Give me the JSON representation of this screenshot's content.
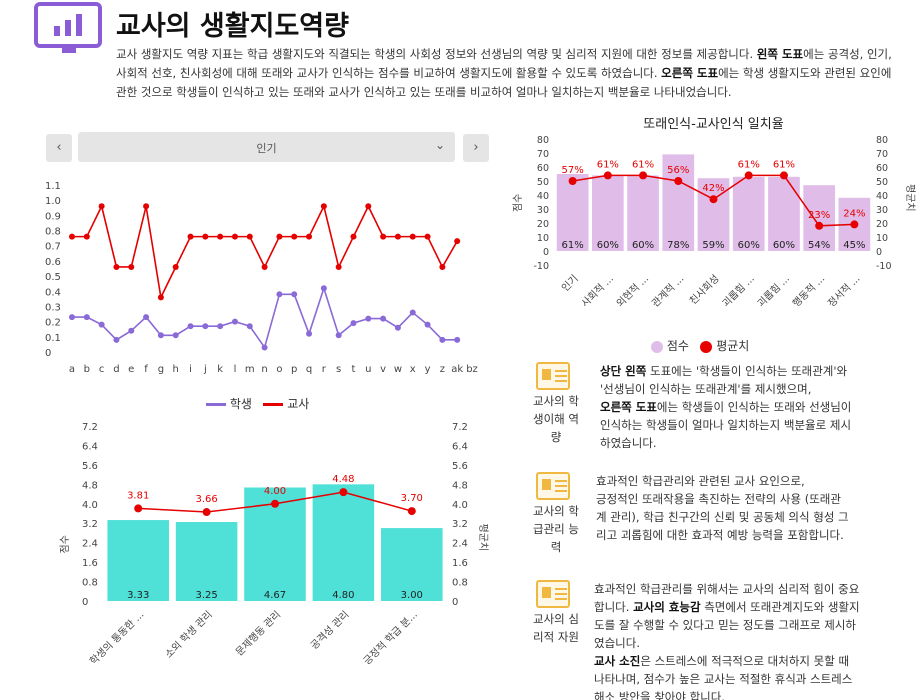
{
  "header": {
    "title": "교사의 생활지도역량",
    "desc_1": "교사 생활지도 역량 지표는 학급 생활지도와 직결되는 학생의 사회성 정보와 선생님의 역량 및 심리적 지원에 대한 정보를 제공합니다. ",
    "desc_b1": "왼쪽 도표",
    "desc_2": "에는 공격성, 인기, 사회적 선호, 친사회성에 대해 또래와 교사가 인식하는 점수를 비교하여 생활지도에 활용할 수 있도록 하였습니다. ",
    "desc_b2": "오른쪽 도표",
    "desc_3": "에는 학생 생활지도와 관련된 요인에 관한 것으로 학생들이 인식하고 있는 또래와 교사가 인식하고 있는 또래를 비교하여 얼마나 일치하는지 백분율로 나타내었습니다."
  },
  "selector": {
    "prev": "‹",
    "next": "›",
    "value": "인기",
    "caret": "⌄"
  },
  "colors": {
    "accent": "#8a5cd6",
    "student": "#8a6ad6",
    "teacher": "#e50000",
    "bar": "#e0bde8",
    "teal": "#4fe0d8",
    "red_dot": "#e60000"
  },
  "chart_data": [
    {
      "type": "line",
      "x": [
        "a",
        "b",
        "c",
        "d",
        "e",
        "f",
        "g",
        "h",
        "i",
        "j",
        "k",
        "l",
        "m",
        "n",
        "o",
        "p",
        "q",
        "r",
        "s",
        "t",
        "u",
        "v",
        "w",
        "x",
        "y",
        "z",
        "ak",
        "bz"
      ],
      "yticks": [
        "1.1",
        "1.0",
        "0.9",
        "0.8",
        "0.7",
        "0.6",
        "0.5",
        "0.4",
        "0.3",
        "0.2",
        "0.1",
        "0"
      ],
      "ylim": [
        0,
        1.1
      ],
      "series": [
        {
          "name": "학생",
          "values": [
            0.23,
            0.23,
            0.18,
            0.08,
            0.14,
            0.23,
            0.11,
            0.11,
            0.17,
            0.17,
            0.17,
            0.2,
            0.17,
            0.03,
            0.38,
            0.38,
            0.12,
            0.42,
            0.11,
            0.19,
            0.22,
            0.22,
            0.16,
            0.26,
            0.18,
            0.08,
            0.08,
            null
          ]
        },
        {
          "name": "교사",
          "values": [
            0.76,
            0.76,
            0.96,
            0.56,
            0.56,
            0.96,
            0.36,
            0.56,
            0.76,
            0.76,
            0.76,
            0.76,
            0.76,
            0.56,
            0.76,
            0.76,
            0.76,
            0.96,
            0.56,
            0.76,
            0.96,
            0.76,
            0.76,
            0.76,
            0.76,
            0.56,
            0.73,
            null
          ]
        }
      ]
    },
    {
      "type": "bar",
      "title": "또래인식-교사인식 일치율",
      "categories": [
        "인기",
        "사회적 ...",
        "외현적 ...",
        "관계적 ...",
        "친사회성",
        "괴롭힘 ...",
        "괴롭힘 ...",
        "행동적 ...",
        "정서적 ..."
      ],
      "yticks": [
        "80",
        "70",
        "60",
        "50",
        "40",
        "30",
        "20",
        "10",
        "0",
        "-10"
      ],
      "ylim": [
        -10,
        80
      ],
      "ylabel": "점수",
      "y2label": "평균치",
      "series": [
        {
          "name": "점수",
          "values": [
            55,
            54,
            54,
            69,
            52,
            53,
            53,
            47,
            38
          ],
          "labels": [
            "61%",
            "60%",
            "60%",
            "78%",
            "59%",
            "60%",
            "60%",
            "54%",
            "45%"
          ]
        },
        {
          "name": "평균치",
          "values": [
            50,
            54,
            54,
            50,
            37,
            54,
            54,
            18,
            19
          ],
          "labels": [
            "57%",
            "61%",
            "61%",
            "56%",
            "42%",
            "61%",
            "61%",
            "23%",
            "24%"
          ]
        }
      ]
    },
    {
      "type": "bar",
      "categories": [
        "학생의 통동한 ...",
        "소외 학생 관리",
        "문제행동 관리",
        "공격성 관리",
        "긍정적 학급 분..."
      ],
      "yticks": [
        "7.2",
        "6.4",
        "5.6",
        "4.8",
        "4.0",
        "3.2",
        "2.4",
        "1.6",
        "0.8",
        "0"
      ],
      "ylim": [
        0,
        7.2
      ],
      "ylabel": "점수",
      "y2label": "평균치",
      "series": [
        {
          "name": "점수",
          "values": [
            3.33,
            3.25,
            4.67,
            4.8,
            3.0
          ],
          "labels": [
            "3.33",
            "3.25",
            "4.67",
            "4.80",
            "3.00"
          ]
        },
        {
          "name": "평균치",
          "values": [
            3.81,
            3.66,
            4.0,
            4.48,
            3.7
          ],
          "labels": [
            "3.81",
            "3.66",
            "4.00",
            "4.48",
            "3.70"
          ]
        }
      ]
    }
  ],
  "sections": [
    {
      "label": "교사의 학생이해 역량",
      "lines": [
        [
          {
            "b": "상단 왼쪽"
          },
          {
            "t": " 도표에는 '학생들이 인식하는 또래관계'와"
          }
        ],
        [
          {
            "t": "'선생님이 인식하는 또래관계'를 제시했으며,"
          }
        ],
        [
          {
            "b": "오른쪽 도표"
          },
          {
            "t": "에는 학생들이 인식하는 또래와 선생님이"
          }
        ],
        [
          {
            "t": "인식하는 학생들이 얼마나 일치하는지 백분율로 제시"
          }
        ],
        [
          {
            "t": "하였습니다."
          }
        ]
      ]
    },
    {
      "label": "교사의 학급관리 능력",
      "lines": [
        [
          {
            "t": "효과적인 학급관리와 관련된 교사 요인으로,"
          }
        ],
        [
          {
            "t": "긍정적인 또래작용을 촉진하는 전략의 사용 (또래관"
          }
        ],
        [
          {
            "t": "계 관리), 학급 친구간의 신뢰 및 공동체 의식 형성 그"
          }
        ],
        [
          {
            "t": "리고 괴롭힘에 대한 효과적 예방 능력을 포함합니다."
          }
        ]
      ]
    },
    {
      "label": "교사의 심리적 자원",
      "lines": [
        [
          {
            "t": "효과적인 학급관리를 위해서는 교사의 심리적 힘이 중요"
          }
        ],
        [
          {
            "t": "합니다. "
          },
          {
            "b": "교사의 효능감"
          },
          {
            "t": " 측면에서 또래관계지도와 생활지"
          }
        ],
        [
          {
            "t": "도를 잘 수행할 수 있다고 믿는 정도를 그래프로 제시하"
          }
        ],
        [
          {
            "t": "였습니다."
          }
        ],
        [
          {
            "b": "교사 소진"
          },
          {
            "t": "은 스트레스에 적극적으로 대처하지 못할 때"
          }
        ],
        [
          {
            "t": "나타나며, 점수가 높은 교사는 적절한 휴식과 스트레스"
          }
        ],
        [
          {
            "t": "해소 방안을 찾아야 합니다."
          }
        ]
      ]
    }
  ]
}
